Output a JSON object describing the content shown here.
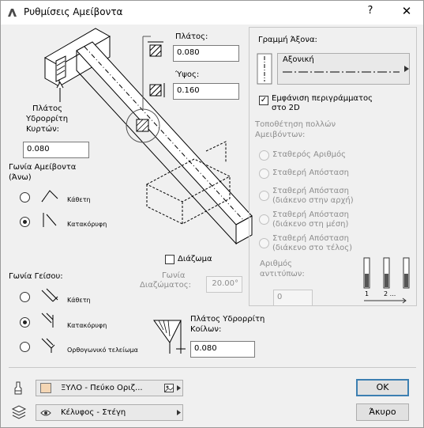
{
  "window": {
    "title": "Ρυθμίσεις Αμείβοντα",
    "help": "?",
    "close": "✕"
  },
  "width_label": "Πλάτος:",
  "width_value": "0.080",
  "height_label": "Ύψος:",
  "height_value": "0.160",
  "nailer_width_label_1": "Πλάτος",
  "nailer_width_label_2": "Υδρορρίτη",
  "nailer_width_label_3": "Κυρτών:",
  "nailer_width_value": "0.080",
  "rafter_angle_label_1": "Γωνία Αμείβοντα",
  "rafter_angle_label_2": "(Άνω)",
  "rafter_options": [
    "Κάθετη",
    "Κατακόρυφη"
  ],
  "eave_label": "Γωνία Γείσου:",
  "eave_options": [
    "Κάθετη",
    "Κατακόρυφη",
    "Ορθογωνικό τελείωμα"
  ],
  "bracing_label": "Διάζωμα",
  "bracing_angle_label_1": "Γωνία",
  "bracing_angle_label_2": "Διαζώματος:",
  "bracing_angle_value": "20.00°",
  "valley_width_label_1": "Πλάτος Υδρορρίτη",
  "valley_width_label_2": "Κοίλων:",
  "valley_width_value": "0.080",
  "axis_line_label": "Γραμμή Άξονα:",
  "axis_line_value": "Αξονική",
  "show_outline_label_1": "Εμφάνιση περιγράμματος",
  "show_outline_label_2": "στο 2D",
  "placement_label_1": "Τοποθέτηση πολλών",
  "placement_label_2": "Αμειβόντων:",
  "placement_options": [
    {
      "l1": "Σταθερός Αριθμός",
      "l2": ""
    },
    {
      "l1": "Σταθερή Απόσταση",
      "l2": ""
    },
    {
      "l1": "Σταθερή Απόσταση",
      "l2": "(διάκενο στην αρχή)"
    },
    {
      "l1": "Σταθερή Απόσταση",
      "l2": "(διάκενο στη μέση)"
    },
    {
      "l1": "Σταθερή Απόσταση",
      "l2": "(διάκενο στο τέλος)"
    }
  ],
  "copies_label_1": "Αριθμός",
  "copies_label_2": "αντιτύπων:",
  "copies_value": "0",
  "copies_diagram_labels": [
    "1",
    "2 ..."
  ],
  "material_value": "ΞΥΛΟ - Πεύκο Οριζ...",
  "layer_value": "Κέλυφος - Στέγη",
  "ok_label": "OK",
  "cancel_label": "Άκυρο"
}
